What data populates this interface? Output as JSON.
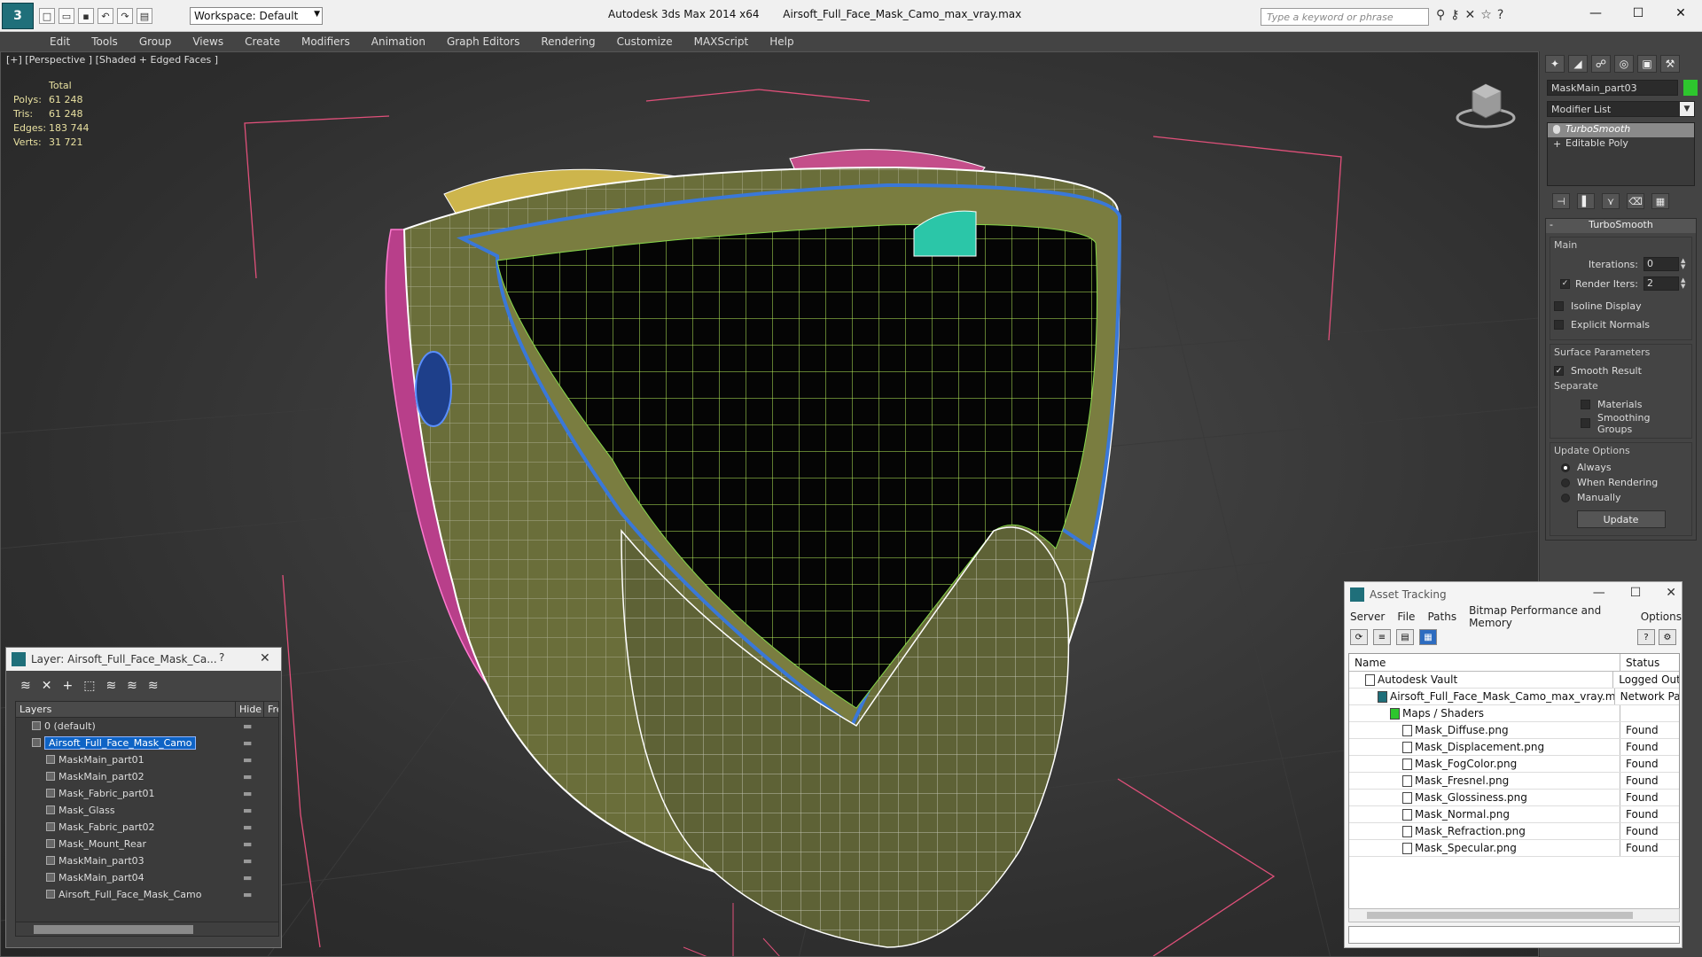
{
  "titlebar": {
    "workspace": "Workspace: Default",
    "app": "Autodesk 3ds Max  2014 x64",
    "file": "Airsoft_Full_Face_Mask_Camo_max_vray.max",
    "search_placeholder": "Type a keyword or phrase"
  },
  "menu": [
    "Edit",
    "Tools",
    "Group",
    "Views",
    "Create",
    "Modifiers",
    "Animation",
    "Graph Editors",
    "Rendering",
    "Customize",
    "MAXScript",
    "Help"
  ],
  "viewport": {
    "label": "[+] [Perspective ] [Shaded + Edged Faces ]",
    "stats": {
      "header": "Total",
      "rows": [
        {
          "k": "Polys:",
          "v": "61 248"
        },
        {
          "k": "Tris:",
          "v": "61 248"
        },
        {
          "k": "Edges:",
          "v": "183 744"
        },
        {
          "k": "Verts:",
          "v": "31 721"
        }
      ]
    }
  },
  "command_panel": {
    "object_name": "MaskMain_part03",
    "object_color": "#2ec62e",
    "modifier_list": "Modifier List",
    "stack": [
      "TurboSmooth",
      "Editable Poly"
    ],
    "rollout": "TurboSmooth",
    "main_group": "Main",
    "iterations_label": "Iterations:",
    "iterations": "0",
    "render_iters_label": "Render Iters:",
    "render_iters": "2",
    "isoline": "Isoline Display",
    "explicit_normals": "Explicit Normals",
    "surface_group": "Surface Parameters",
    "smooth_result": "Smooth Result",
    "separate": "Separate",
    "materials": "Materials",
    "smoothing_groups": "Smoothing Groups",
    "update_group": "Update Options",
    "always": "Always",
    "when_rendering": "When Rendering",
    "manually": "Manually",
    "update_btn": "Update"
  },
  "layer_window": {
    "title": "Layer: Airsoft_Full_Face_Mask_Ca...",
    "help": "?",
    "columns": [
      "Layers",
      "Hide",
      "Fre"
    ],
    "rows": [
      {
        "name": "0 (default)",
        "level": 0
      },
      {
        "name": "Airsoft_Full_Face_Mask_Camo",
        "level": 0,
        "selected": true
      },
      {
        "name": "MaskMain_part01",
        "level": 1
      },
      {
        "name": "MaskMain_part02",
        "level": 1
      },
      {
        "name": "Mask_Fabric_part01",
        "level": 1
      },
      {
        "name": "Mask_Glass",
        "level": 1
      },
      {
        "name": "Mask_Fabric_part02",
        "level": 1
      },
      {
        "name": "Mask_Mount_Rear",
        "level": 1
      },
      {
        "name": "MaskMain_part03",
        "level": 1
      },
      {
        "name": "MaskMain_part04",
        "level": 1
      },
      {
        "name": "Airsoft_Full_Face_Mask_Camo",
        "level": 1
      }
    ]
  },
  "asset_window": {
    "title": "Asset Tracking",
    "menu": [
      "Server",
      "File",
      "Paths",
      "Bitmap Performance and Memory",
      "Options"
    ],
    "col_name": "Name",
    "col_status": "Status",
    "rows": [
      {
        "name": "Autodesk Vault",
        "status": "Logged Out",
        "indent": 1
      },
      {
        "name": "Airsoft_Full_Face_Mask_Camo_max_vray.max",
        "status": "Network Pa",
        "indent": 2
      },
      {
        "name": "Maps / Shaders",
        "status": "",
        "indent": 3
      },
      {
        "name": "Mask_Diffuse.png",
        "status": "Found",
        "indent": 4
      },
      {
        "name": "Mask_Displacement.png",
        "status": "Found",
        "indent": 4
      },
      {
        "name": "Mask_FogColor.png",
        "status": "Found",
        "indent": 4
      },
      {
        "name": "Mask_Fresnel.png",
        "status": "Found",
        "indent": 4
      },
      {
        "name": "Mask_Glossiness.png",
        "status": "Found",
        "indent": 4
      },
      {
        "name": "Mask_Normal.png",
        "status": "Found",
        "indent": 4
      },
      {
        "name": "Mask_Refraction.png",
        "status": "Found",
        "indent": 4
      },
      {
        "name": "Mask_Specular.png",
        "status": "Found",
        "indent": 4
      }
    ]
  }
}
